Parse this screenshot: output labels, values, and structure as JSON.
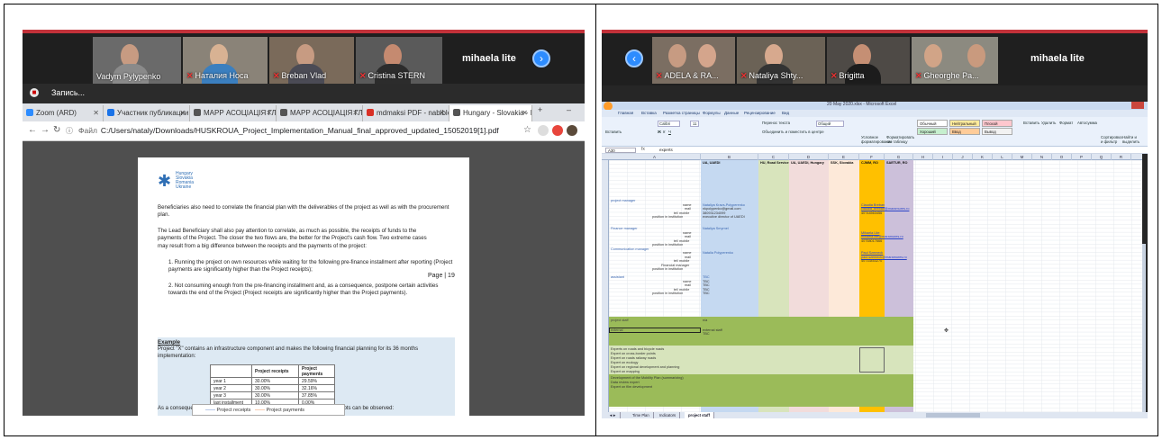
{
  "left_panel": {
    "participants": [
      {
        "name": "Vadym Pylypenko",
        "mic_muted": false
      },
      {
        "name": "Наталия Носа",
        "mic_muted": true
      },
      {
        "name": "Breban Vlad",
        "mic_muted": true
      },
      {
        "name": "Cristina STERN",
        "mic_muted": true
      }
    ],
    "host": "mihaela lite",
    "recording_label": "Запись...",
    "browser_tabs": [
      {
        "label": "Zoom (ARD)",
        "color": "#2d8cff"
      },
      {
        "label": "Участник публикации",
        "color": "#1a73e8"
      },
      {
        "label": "МАРР АСОЦІАЦІЯ ГЛ",
        "color": "#555555"
      },
      {
        "label": "МАРР АСОЦІАЦІЯ ГЛ",
        "color": "#555555"
      },
      {
        "label": "mdmaksi PDF - nabiblo",
        "color": "#d93025"
      },
      {
        "label": "Hungary - Slovakia - R",
        "color": "#555555"
      }
    ],
    "address_prefix": "Файл",
    "url": "C:/Users/nataly/Downloads/HUSKROUA_Project_Implementation_Manual_final_approved_updated_15052019[1].pdf",
    "pdf": {
      "logo_lines": [
        "Hungary",
        "Slovakia",
        "Romania",
        "Ukraine"
      ],
      "page_label": "Page | 19",
      "paragraphs": [
        "Beneficiaries also need to correlate the financial plan with the deliverables of the project as well as with the procurement plan.",
        "The Lead Beneficiary shall also pay attention to correlate, as much as possible, the receipts of funds to the payments of the Project. The closer the two flows are, the better for the Project's cash flow. Two extreme cases may result from a big difference between the receipts and the payments of the project:",
        "1.   Running the project on own resources while waiting for the following pre-finance installment after reporting (Project payments are significantly higher than the Project receipts);",
        "2.   Not consuming enough from the pre-financing installment and, as a consequence, postpone certain activities towards the end of the Project (Project receipts are significantly higher than the Project payments)."
      ],
      "example_title": "Example",
      "example_text": "Project \"X\" contains an infrastructure component and makes the following financial planning for its 36 months implementation:",
      "table_headers": [
        "",
        "Project receipts",
        "Project payments"
      ],
      "table_rows": [
        [
          "year 1",
          "30.00%",
          "29.59%"
        ],
        [
          "year 2",
          "30.00%",
          "32.16%"
        ],
        [
          "year 3",
          "30.00%",
          "37.85%"
        ],
        [
          "last installment",
          "10.00%",
          "0.00%"
        ]
      ],
      "consequence_text": "As a consequence, the following graphic (simplified) of its payments and receipts can be observed:",
      "legend": [
        "Project receipts",
        "Project payments"
      ]
    }
  },
  "right_panel": {
    "participants": [
      {
        "name": "ADELA & RA...",
        "mic_muted": true
      },
      {
        "name": "Nataliya Shty...",
        "mic_muted": true
      },
      {
        "name": "Brigitta",
        "mic_muted": true
      },
      {
        "name": "Gheorghe Pa...",
        "mic_muted": true
      }
    ],
    "host": "mihaela lite",
    "excel_title": "20 May 2020.xlsx - Microsoft Excel",
    "menu": [
      "Главная",
      "Вставка",
      "Разметка страницы",
      "Формулы",
      "Данные",
      "Рецензирование",
      "Вид"
    ],
    "ribbon": {
      "font_name": "Calibri",
      "font_size": "11",
      "wrap_text": "Перенос текста",
      "merge": "Объединить и поместить в центре",
      "number_format": "Общий",
      "paste": "Вставить",
      "cond_format": "Условное форматирование",
      "format_table": "Форматировать как таблицу",
      "insert": "Вставить",
      "delete": "Удалить",
      "format": "Формат",
      "autosum": "Автосумма",
      "sort": "Сортировка и фильтр",
      "find": "Найти и выделить",
      "styles": [
        {
          "label": "Обычный",
          "color": "#ffffff"
        },
        {
          "label": "Нейтральный",
          "color": "#ffeb9c"
        },
        {
          "label": "Плохой",
          "color": "#ffc7ce"
        },
        {
          "label": "Хороший",
          "color": "#c6efce"
        },
        {
          "label": "Ввод",
          "color": "#ffcc99"
        },
        {
          "label": "Вывод",
          "color": "#f2f2f2"
        }
      ]
    },
    "name_box": "A30",
    "formula": "experts",
    "col_letters": [
      "A",
      "B",
      "C",
      "D",
      "E",
      "F",
      "G",
      "H",
      "I",
      "J",
      "K",
      "L",
      "M",
      "N",
      "O",
      "P",
      "Q",
      "R"
    ],
    "partner_headers": [
      "UA, UAEDI",
      "HU, Road Service",
      "UA, UAEDI, Hungary",
      "SSK, Slovakia",
      "CJMM, RO",
      "SAETUR, RO"
    ],
    "sections": [
      "project manager",
      "Finance manager",
      "Communication manager",
      "assistant"
    ],
    "field_labels": [
      "name",
      "mail",
      "tel/ mobile",
      "position in institution"
    ],
    "extra_label": "Financial manager",
    "ua_pm": [
      "Nataliya Kravs-Polyperenko",
      "nkpolypenko@gmail.com",
      "380931234099",
      "executive director of UAEDI"
    ],
    "ua_fm": "Nataliya Smyrnel",
    "ua_cm": "Natalia Polyperenko",
    "ro_pm": [
      "Claudia Breban",
      "claudia_breban@maramures.ro",
      "40744563456"
    ],
    "ro_fm": [
      "Mihaela Lite",
      "mihaela.lite@maramures.ro",
      "40758017666"
    ],
    "ro_cm": [
      "Paul Szemeck",
      "paul.szemeck@maramures.ro",
      "40733453270"
    ],
    "tbc": "TBC",
    "project_staff_label": "project staff",
    "staff_col_note": "n/a",
    "external_label": "external",
    "external_note": "external staff",
    "experts": [
      "Experts on roads and bicycle roads",
      "Expert on cross-border points",
      "Expert on roads railway roads",
      "Expert on ecology",
      "Expert on regional development and planning",
      "Expert on mapping",
      "Development of the Mobility Plan (summarizing)",
      "Data review expert",
      "Expert on film development"
    ],
    "sheets": [
      "Time Plan",
      "Indicators",
      "project staff"
    ],
    "colors": {
      "ua_col": "#c5d9f1",
      "hu_col": "#d8e4bc",
      "ua_hu_col": "#f2dcdb",
      "sk_col": "#fde9d9",
      "ro_cjmm_col": "#ffc000",
      "ro_saetur_col": "#ccc0da",
      "green_band": "#9bbb59",
      "light_green": "#d7e4bc"
    }
  }
}
